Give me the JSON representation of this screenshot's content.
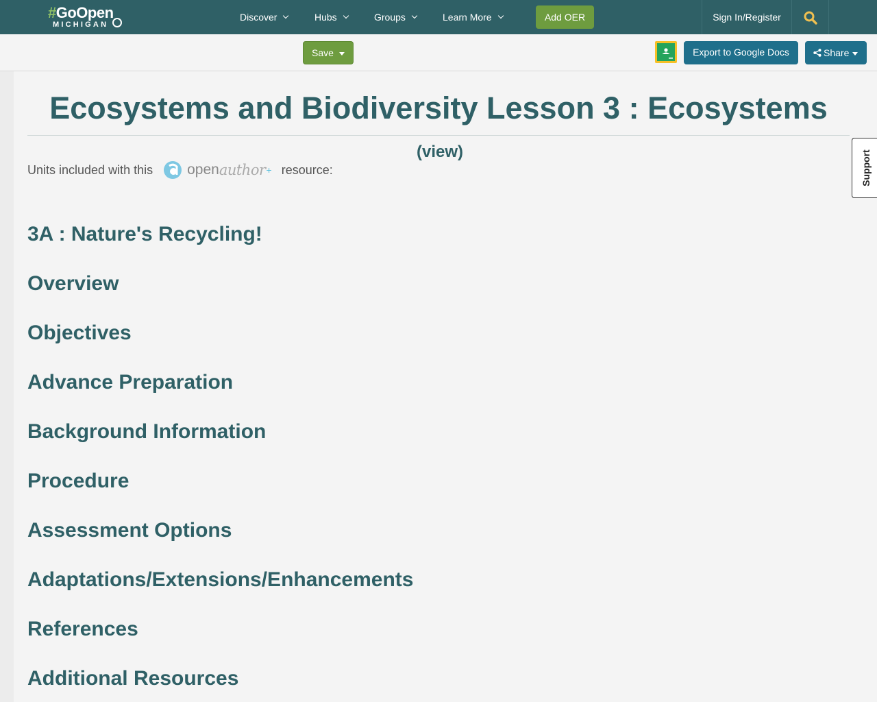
{
  "logo": {
    "line1_hash": "#",
    "line1_text": "GoOpen",
    "line2": "MICHIGAN"
  },
  "nav": {
    "items": [
      {
        "label": "Discover"
      },
      {
        "label": "Hubs"
      },
      {
        "label": "Groups"
      },
      {
        "label": "Learn More"
      }
    ],
    "add_oer": "Add OER",
    "sign_in": "Sign In/Register"
  },
  "toolbar": {
    "save_label": "Save",
    "export_label": "Export to Google Docs",
    "share_label": "Share"
  },
  "page": {
    "title": "Ecosystems and Biodiversity Lesson 3 : Ecosystems",
    "view_link": "(view)",
    "units_prefix": "Units included with this",
    "units_suffix": "resource:",
    "openauthor_open": "open",
    "openauthor_author": "author",
    "openauthor_plus": "+"
  },
  "sections": [
    "3A : Nature's Recycling!",
    "Overview",
    "Objectives",
    "Advance Preparation",
    "Background Information",
    "Procedure",
    "Assessment Options",
    "Adaptations/Extensions/Enhancements",
    "References",
    "Additional Resources"
  ],
  "support": {
    "label": "Support"
  },
  "colors": {
    "navbar": "#2f6066",
    "accent_green": "#6e9c3f",
    "accent_blue": "#1f6f8b",
    "search_icon": "#f0c050"
  }
}
